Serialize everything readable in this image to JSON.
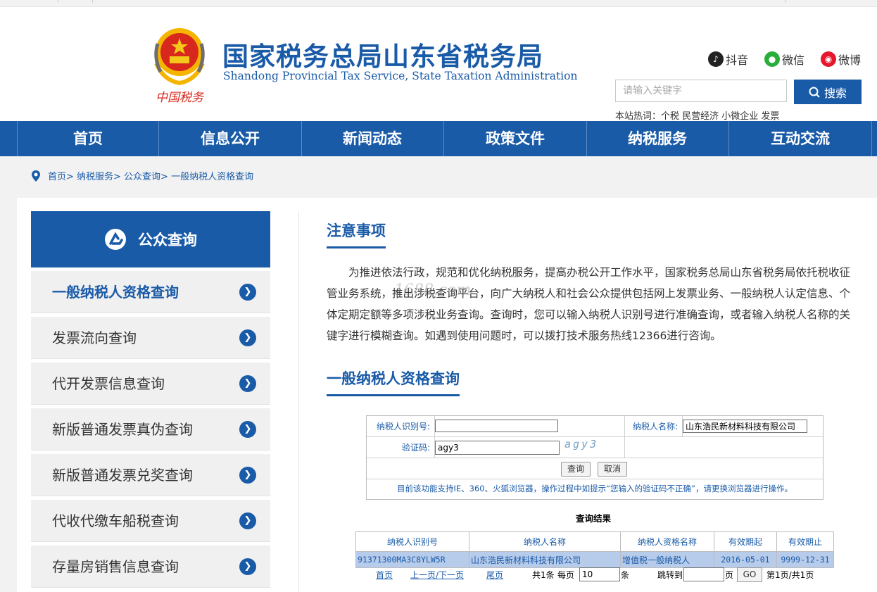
{
  "header": {
    "title_cn": "国家税务总局山东省税务局",
    "title_en": "Shandong Provincial Tax Service, State Taxation Administration",
    "emblem_text": "中国税务",
    "social": [
      {
        "label": "抖音",
        "icon": "douyin-icon",
        "color": "#222222"
      },
      {
        "label": "微信",
        "icon": "wechat-icon",
        "color": "#2aae3b"
      },
      {
        "label": "微博",
        "icon": "weibo-icon",
        "color": "#e6162d"
      }
    ],
    "search_placeholder": "请输入关键字",
    "search_button": "搜索",
    "hot_words": "本站热词：个税 民营经济 小微企业 发票"
  },
  "nav": [
    "首页",
    "信息公开",
    "新闻动态",
    "政策文件",
    "纳税服务",
    "互动交流"
  ],
  "breadcrumb": "首页> 纳税服务> 公众查询> 一般纳税人资格查询",
  "sidebar": {
    "title": "公众查询",
    "items": [
      "一般纳税人资格查询",
      "发票流向查询",
      "代开发票信息查询",
      "新版普通发票真伪查询",
      "新版普通发票兑奖查询",
      "代收代缴车船税查询",
      "存量房销售信息查询"
    ]
  },
  "notice": {
    "title": "注意事项",
    "text": "为推进依法行政，规范和优化纳税服务，提高办税公开工作水平，国家税务总局山东省税务局依托税收征管业务系统，推出涉税查询平台，向广大纳税人和社会公众提供包括网上发票业务、一般纳税人认定信息、个体定期定额等多项涉税业务查询。查询时，您可以输入纳税人识别号进行准确查询，或者输入纳税人名称的关键字进行模糊查询。如遇到使用问题时，可以拨打技术服务热线12366进行咨询。",
    "watermark": "1688.com"
  },
  "query": {
    "title": "一般纳税人资格查询",
    "id_label": "纳税人识别号:",
    "id_value": "",
    "name_label": "纳税人名称:",
    "name_value": "山东浩民新材料科技有限公司",
    "captcha_label": "验证码:",
    "captcha_value": "agy3",
    "captcha_image_text": "agy3",
    "submit": "查询",
    "cancel": "取消",
    "tip": "目前该功能支持IE、360、火狐浏览器，操作过程中如提示“您输入的验证码不正确”，请更换浏览器进行操作。"
  },
  "results": {
    "title": "查询结果",
    "columns": [
      "纳税人识别号",
      "纳税人名称",
      "纳税人资格名称",
      "有效期起",
      "有效期止"
    ],
    "rows": [
      [
        "91371300MA3C8YLW5R",
        "山东浩民新材料科技有限公司",
        "增值税一般纳税人",
        "2016-05-01",
        "9999-12-31"
      ]
    ]
  },
  "pager": {
    "first": "首页",
    "prev_next": "上一页/下一页",
    "last": "尾页",
    "total": "共1条",
    "per_page_label": "每页",
    "per_page_value": "10",
    "per_page_unit": "条",
    "jump_label": "跳转到",
    "jump_value": "",
    "jump_unit": "页",
    "go": "GO",
    "page_info": "第1页/共1页"
  }
}
